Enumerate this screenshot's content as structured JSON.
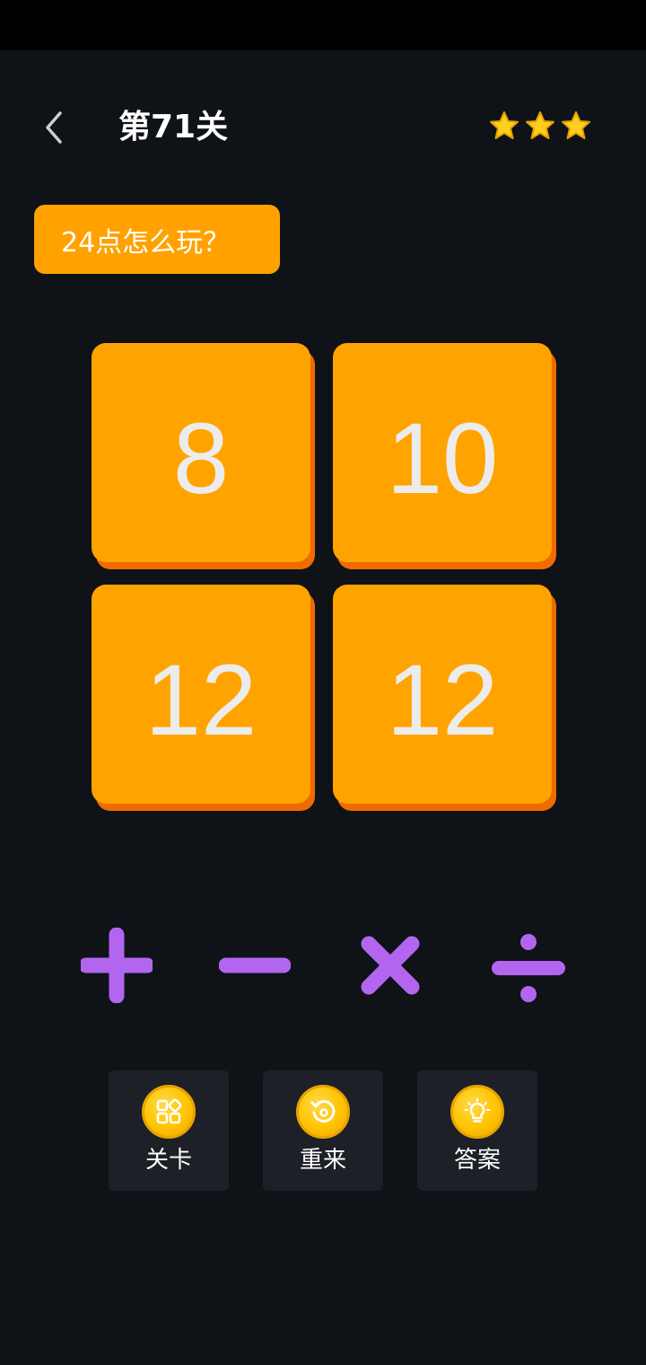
{
  "header": {
    "title": "第71关",
    "stars": 3
  },
  "howto_label": "24点怎么玩？",
  "cards": [
    "8",
    "10",
    "12",
    "12"
  ],
  "operators": [
    "plus",
    "minus",
    "multiply",
    "divide"
  ],
  "actions": {
    "levels_label": "关卡",
    "restart_label": "重来",
    "answer_label": "答案"
  },
  "colors": {
    "background": "#0f1217",
    "card": "#ffa300",
    "card_shadow": "#f06a00",
    "operator": "#b266f0",
    "button": "#ffa200",
    "action_bg": "#1d2027",
    "coin": "#ffc400"
  }
}
